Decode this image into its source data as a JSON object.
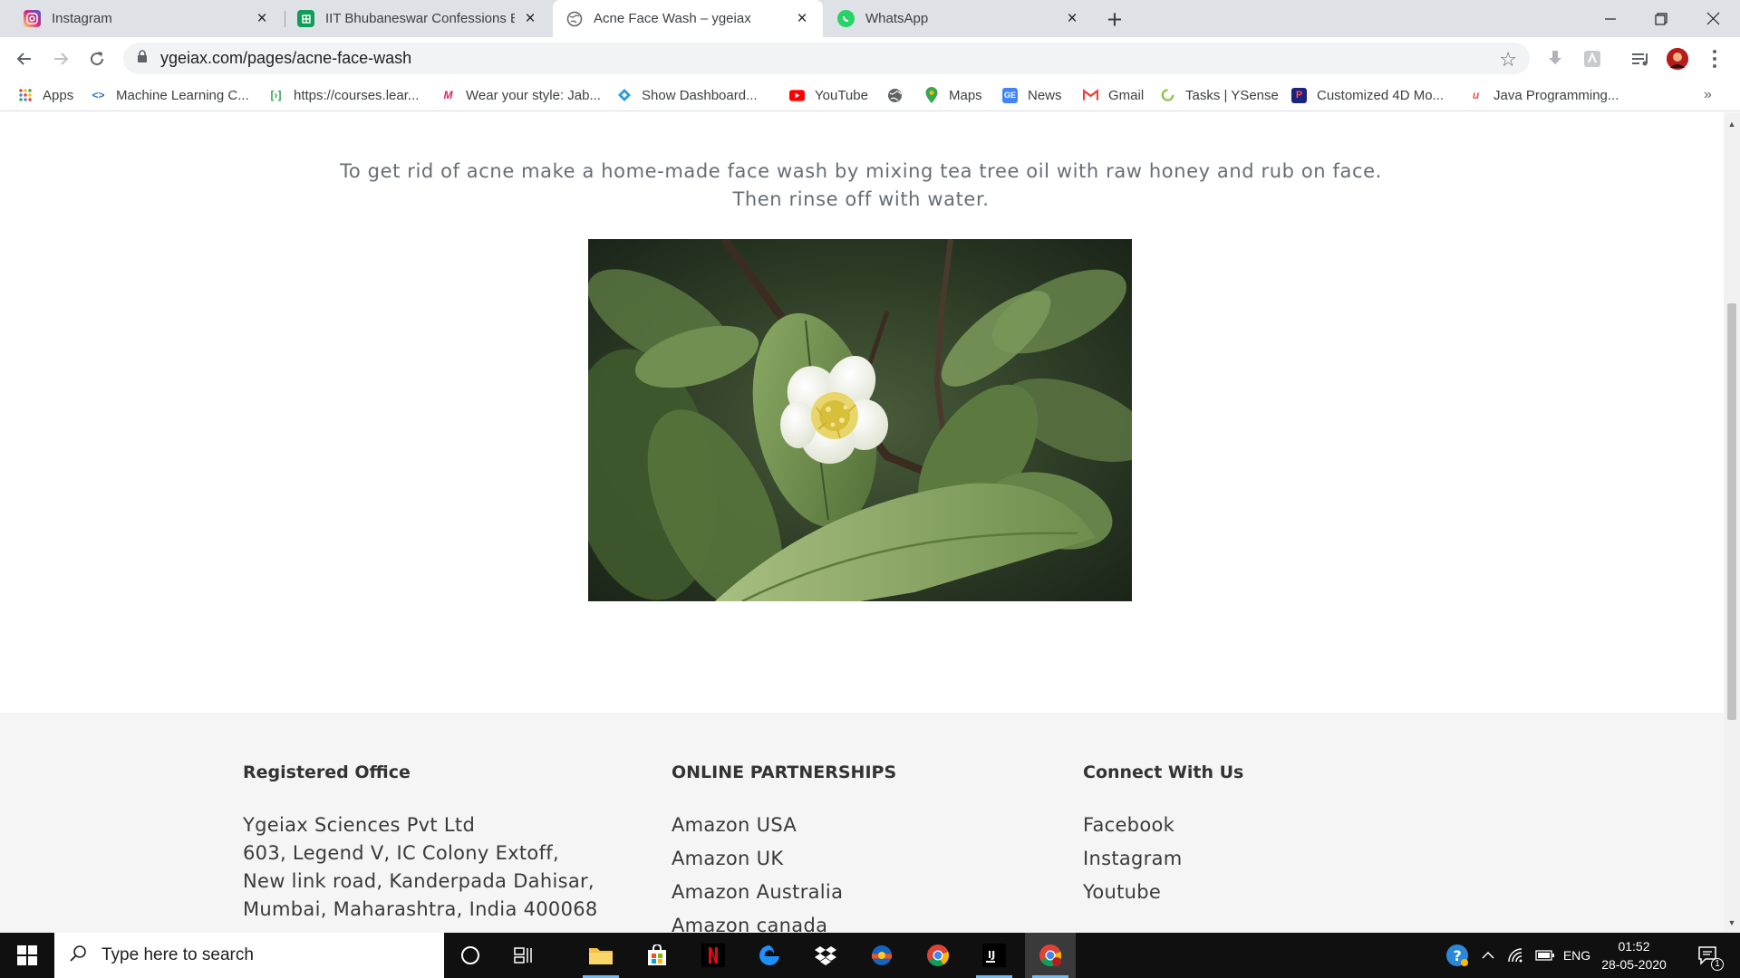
{
  "browser": {
    "tabs": [
      {
        "title": "Instagram",
        "icon": "instagram-icon",
        "active": false
      },
      {
        "title": "IIT Bhubaneswar Confessions Box",
        "icon": "google-sheets-icon",
        "active": false
      },
      {
        "title": "Acne Face Wash – ygeiax",
        "icon": "globe-icon",
        "active": true
      },
      {
        "title": "WhatsApp",
        "icon": "whatsapp-icon",
        "active": false
      }
    ],
    "new_tab_label": "+",
    "url": "ygeiax.com/pages/acne-face-wash",
    "bookmarks": [
      {
        "label": "Apps",
        "icon": "apps-grid-icon"
      },
      {
        "label": "Machine Learning C...",
        "icon": "coursera-icon"
      },
      {
        "label": "https://courses.lear...",
        "icon": "page-icon"
      },
      {
        "label": "Wear your style: Jab...",
        "icon": "myntra-icon"
      },
      {
        "label": "Show Dashboard...",
        "icon": "dashboard-icon"
      },
      {
        "label": "YouTube",
        "icon": "youtube-icon"
      },
      {
        "label": "",
        "icon": "globe-icon"
      },
      {
        "label": "Maps",
        "icon": "maps-icon"
      },
      {
        "label": "News",
        "icon": "news-icon"
      },
      {
        "label": "Gmail",
        "icon": "gmail-icon"
      },
      {
        "label": "Tasks | YSense",
        "icon": "ysense-icon"
      },
      {
        "label": "Customized 4D Mo...",
        "icon": "4d-icon"
      },
      {
        "label": "Java Programming...",
        "icon": "udemy-icon"
      }
    ],
    "bookmarks_overflow": "»"
  },
  "page": {
    "intro_line1": "To get rid of acne make a home-made face wash by mixing tea tree oil with raw honey and rub on face.",
    "intro_line2": "Then rinse off with water.",
    "footer": {
      "office": {
        "heading": "Registered Office",
        "lines": [
          "Ygeiax Sciences Pvt Ltd",
          "603, Legend V, IC Colony Extoff,",
          "New link road, Kanderpada Dahisar,",
          "Mumbai, Maharashtra, India 400068"
        ]
      },
      "partnerships": {
        "heading": "ONLINE PARTNERSHIPS",
        "links": [
          "Amazon USA",
          "Amazon UK",
          "Amazon Australia",
          "Amazon canada"
        ]
      },
      "connect": {
        "heading": "Connect With Us",
        "links": [
          "Facebook",
          "Instagram",
          "Youtube"
        ]
      }
    }
  },
  "taskbar": {
    "search_placeholder": "Type here to search",
    "language": "ENG",
    "time": "01:52",
    "date": "28-05-2020",
    "notification_count": "1"
  }
}
